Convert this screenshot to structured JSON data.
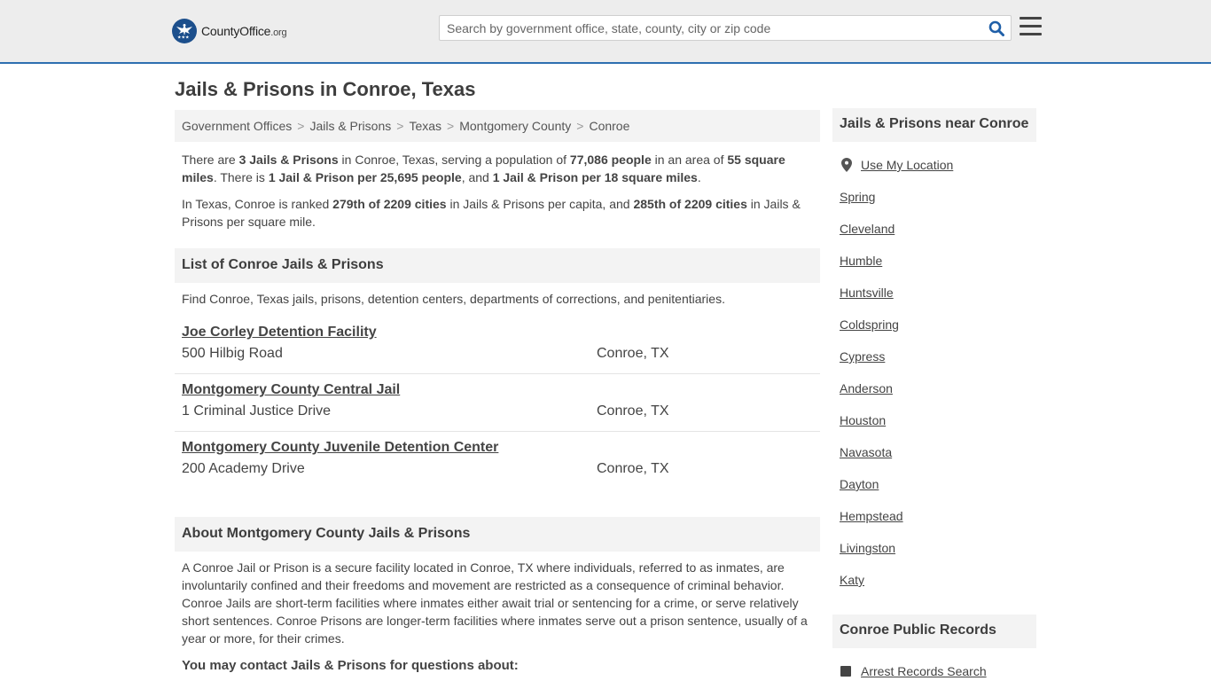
{
  "header": {
    "logo_main": "CountyOffice",
    "logo_suffix": ".org",
    "search_placeholder": "Search by government office, state, county, city or zip code"
  },
  "page_title": "Jails & Prisons in Conroe, Texas",
  "breadcrumbs": [
    "Government Offices",
    "Jails & Prisons",
    "Texas",
    "Montgomery County",
    "Conroe"
  ],
  "intro": {
    "p1": [
      {
        "t": "There are "
      },
      {
        "t": "3 Jails & Prisons",
        "b": true
      },
      {
        "t": " in Conroe, Texas, serving a population of "
      },
      {
        "t": "77,086 people",
        "b": true
      },
      {
        "t": " in an area of "
      },
      {
        "t": "55 square miles",
        "b": true
      },
      {
        "t": ". There is "
      },
      {
        "t": "1 Jail & Prison per 25,695 people",
        "b": true
      },
      {
        "t": ", and "
      },
      {
        "t": "1 Jail & Prison per 18 square miles",
        "b": true
      },
      {
        "t": "."
      }
    ],
    "p2": [
      {
        "t": "In Texas, Conroe is ranked "
      },
      {
        "t": "279th of 2209 cities",
        "b": true
      },
      {
        "t": " in Jails & Prisons per capita, and "
      },
      {
        "t": "285th of 2209 cities",
        "b": true
      },
      {
        "t": " in Jails & Prisons per square mile."
      }
    ]
  },
  "list_section": {
    "heading": "List of Conroe Jails & Prisons",
    "description": "Find Conroe, Texas jails, prisons, detention centers, departments of corrections, and penitentiaries.",
    "items": [
      {
        "name": "Joe Corley Detention Facility",
        "address": "500 Hilbig Road",
        "city": "Conroe, TX"
      },
      {
        "name": "Montgomery County Central Jail",
        "address": "1 Criminal Justice Drive",
        "city": "Conroe, TX"
      },
      {
        "name": "Montgomery County Juvenile Detention Center",
        "address": "200 Academy Drive",
        "city": "Conroe, TX"
      }
    ]
  },
  "about_section": {
    "heading": "About Montgomery County Jails & Prisons",
    "body": "A Conroe Jail or Prison is a secure facility located in Conroe, TX where individuals, referred to as inmates, are involuntarily confined and their freedoms and movement are restricted as a consequence of criminal behavior. Conroe Jails are short-term facilities where inmates either await trial or sentencing for a crime, or serve relatively short sentences. Conroe Prisons are longer-term facilities where inmates serve out a prison sentence, usually of a year or more, for their crimes.",
    "contact_heading": "You may contact Jails & Prisons for questions about:"
  },
  "sidebar": {
    "nearby_heading": "Jails & Prisons near Conroe",
    "use_location": "Use My Location",
    "cities": [
      "Spring",
      "Cleveland",
      "Humble",
      "Huntsville",
      "Coldspring",
      "Cypress",
      "Anderson",
      "Houston",
      "Navasota",
      "Dayton",
      "Hempstead",
      "Livingston",
      "Katy"
    ],
    "records_heading": "Conroe Public Records",
    "records_first": "Arrest Records Search"
  },
  "colors": {
    "accent": "#2e6fb0",
    "logo_blue": "#1c4f8c",
    "search_icon": "#1f5fa8"
  }
}
